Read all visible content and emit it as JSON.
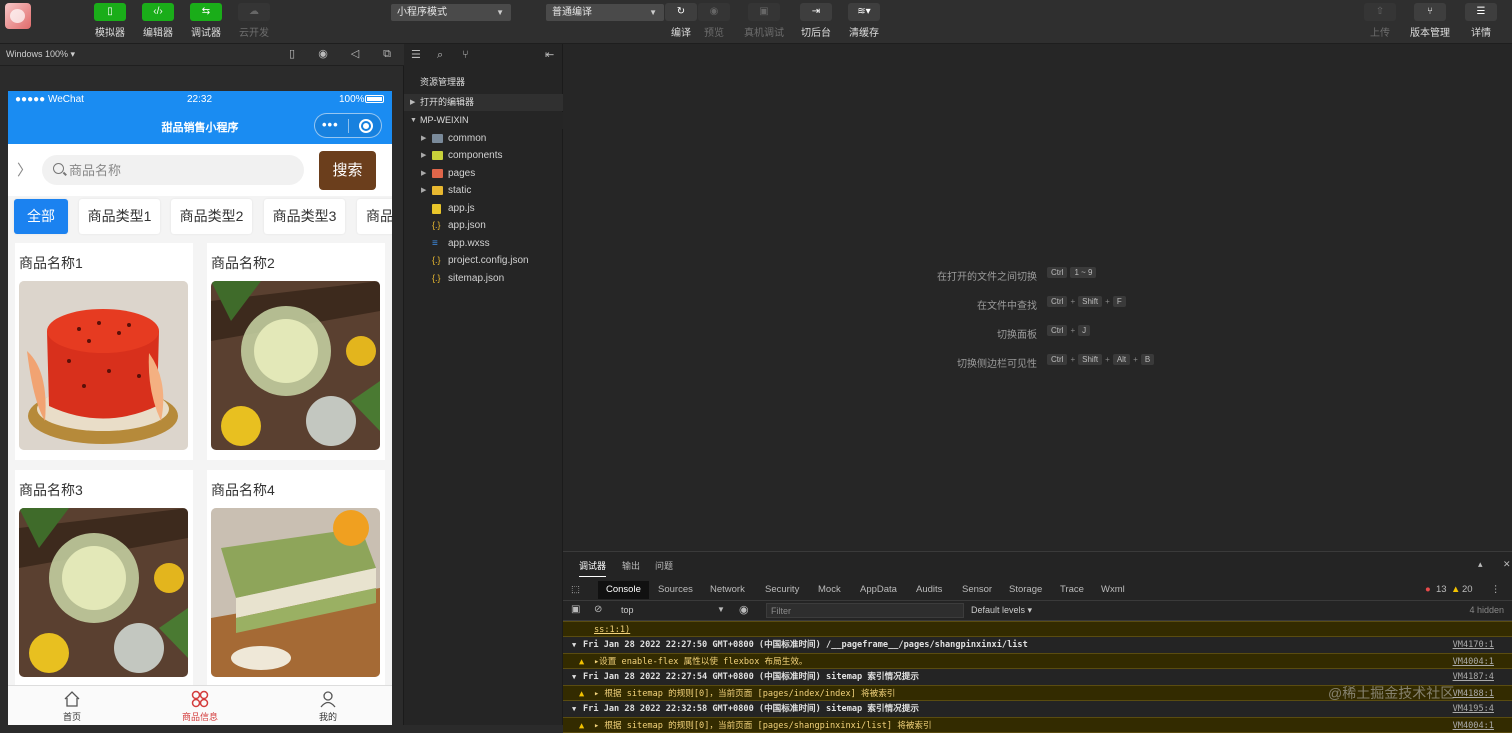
{
  "toolbar": {
    "simulator": "模拟器",
    "editor": "编辑器",
    "debugger": "调试器",
    "cloud": "云开发",
    "mode_select": "小程序模式",
    "compile_select": "普通编译",
    "compile": "编译",
    "preview": "预览",
    "realdebug": "真机调试",
    "background": "切后台",
    "clearcache": "清缓存",
    "upload": "上传",
    "version": "版本管理",
    "details": "详情"
  },
  "simbar": {
    "zoom": "Windows 100% ▾"
  },
  "phone": {
    "status": {
      "carrier": "●●●●● WeChat",
      "time": "22:32",
      "battery": "100%"
    },
    "nav_title": "甜品销售小程序",
    "search_placeholder": "商品名称",
    "search_button": "搜索",
    "categories": [
      "全部",
      "商品类型1",
      "商品类型2",
      "商品类型3",
      "商品"
    ],
    "products": [
      {
        "name": "商品名称1"
      },
      {
        "name": "商品名称2"
      },
      {
        "name": "商品名称3"
      },
      {
        "name": "商品名称4"
      }
    ],
    "tabs": [
      "首页",
      "商品信息",
      "我的"
    ],
    "accent": "#1a8cf2",
    "button_color": "#6b3e1c"
  },
  "explorer": {
    "title": "资源管理器",
    "open_editors": "打开的编辑器",
    "project": "MP-WEIXIN",
    "items": [
      {
        "label": "common",
        "kind": "folder"
      },
      {
        "label": "components",
        "kind": "folder"
      },
      {
        "label": "pages",
        "kind": "folder"
      },
      {
        "label": "static",
        "kind": "folder"
      },
      {
        "label": "app.js",
        "kind": "js"
      },
      {
        "label": "app.json",
        "kind": "json"
      },
      {
        "label": "app.wxss",
        "kind": "wxss"
      },
      {
        "label": "project.config.json",
        "kind": "json"
      },
      {
        "label": "sitemap.json",
        "kind": "json"
      }
    ]
  },
  "editor": {
    "hints": [
      {
        "label": "在打开的文件之间切换",
        "keys": [
          "Ctrl",
          "1 ~ 9"
        ]
      },
      {
        "label": "在文件中查找",
        "keys": [
          "Ctrl",
          "+",
          "Shift",
          "+",
          "F"
        ]
      },
      {
        "label": "切换面板",
        "keys": [
          "Ctrl",
          "+",
          "J"
        ]
      },
      {
        "label": "切换侧边栏可见性",
        "keys": [
          "Ctrl",
          "+",
          "Shift",
          "+",
          "Alt",
          "+",
          "B"
        ]
      }
    ]
  },
  "devtools": {
    "tabs": [
      "调试器",
      "输出",
      "问题"
    ],
    "panels": [
      "Console",
      "Sources",
      "Network",
      "Security",
      "Mock",
      "AppData",
      "Audits",
      "Sensor",
      "Storage",
      "Trace",
      "Wxml"
    ],
    "errors": "13",
    "warnings": "20",
    "context": "top",
    "filter_placeholder": "Filter",
    "levels": "Default levels ▾",
    "hidden": "4 hidden",
    "logs": [
      {
        "type": "cont",
        "text": "ss:1:1)",
        "src": ""
      },
      {
        "type": "group",
        "text": "Fri Jan 28 2022 22:27:50 GMT+0800 (中国标准时间) /__pageframe__/pages/shangpinxinxi/list",
        "src": "VM4170:1"
      },
      {
        "type": "warn",
        "text": "▸设置 enable-flex 属性以使 flexbox 布局生效。",
        "src": "VM4004:1"
      },
      {
        "type": "group",
        "text": "Fri Jan 28 2022 22:27:54 GMT+0800 (中国标准时间) sitemap 索引情况提示",
        "src": "VM4187:4"
      },
      {
        "type": "warn",
        "text": "▸ 根据 sitemap 的规则[0]，当前页面 [pages/index/index] 将被索引",
        "src": "VM4188:1"
      },
      {
        "type": "group",
        "text": "Fri Jan 28 2022 22:32:58 GMT+0800 (中国标准时间) sitemap 索引情况提示",
        "src": "VM4195:4"
      },
      {
        "type": "warn",
        "text": "▸ 根据 sitemap 的规则[0]，当前页面 [pages/shangpinxinxi/list] 将被索引",
        "src": "VM4004:1"
      }
    ]
  },
  "watermark": "@稀土掘金技术社区"
}
